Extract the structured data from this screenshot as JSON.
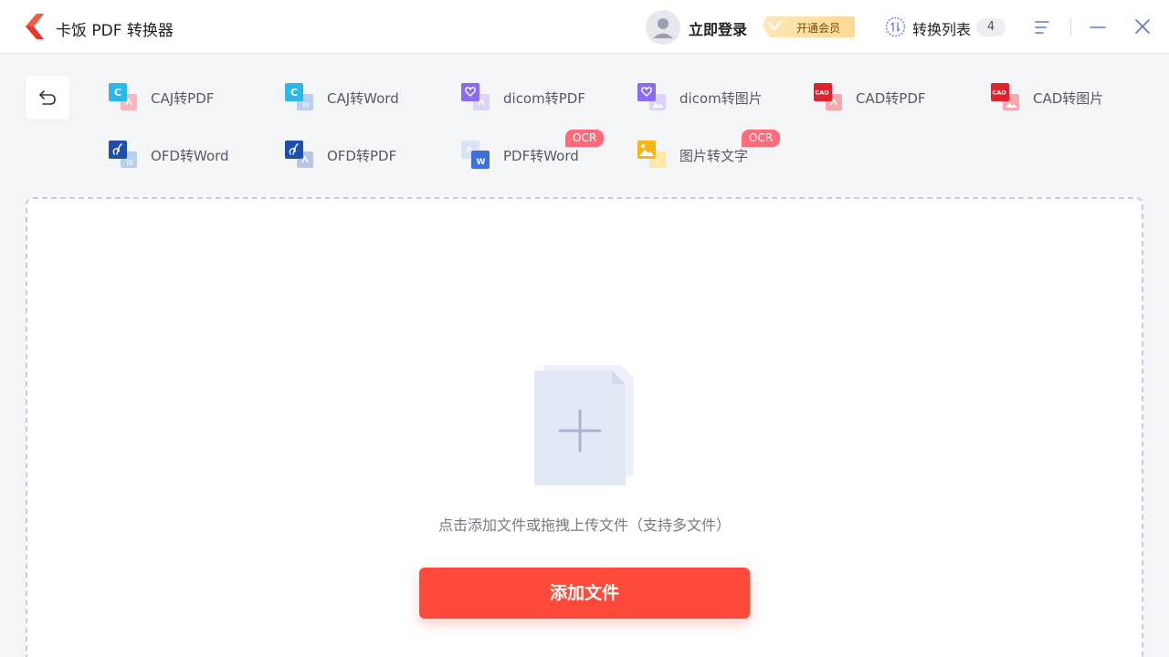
{
  "app": {
    "title": "卡饭 PDF 转换器"
  },
  "header": {
    "login_label": "立即登录",
    "vip_label": "开通会员",
    "convert_list_label": "转换列表",
    "convert_list_count": "4"
  },
  "tools": [
    {
      "label": "CAJ转PDF",
      "icon": "caj-to-pdf-icon"
    },
    {
      "label": "CAJ转Word",
      "icon": "caj-to-word-icon"
    },
    {
      "label": "dicom转PDF",
      "icon": "dicom-to-pdf-icon"
    },
    {
      "label": "dicom转图片",
      "icon": "dicom-to-image-icon"
    },
    {
      "label": "CAD转PDF",
      "icon": "cad-to-pdf-icon"
    },
    {
      "label": "CAD转图片",
      "icon": "cad-to-image-icon"
    },
    {
      "label": "OFD转Word",
      "icon": "ofd-to-word-icon"
    },
    {
      "label": "OFD转PDF",
      "icon": "ofd-to-pdf-icon"
    },
    {
      "label": "PDF转Word",
      "icon": "pdf-to-word-icon",
      "badge": "OCR"
    },
    {
      "label": "图片转文字",
      "icon": "image-to-text-icon",
      "badge": "OCR"
    }
  ],
  "dropzone": {
    "hint": "点击添加文件或拖拽上传文件（支持多文件）",
    "add_button_label": "添加文件"
  },
  "colors": {
    "accent": "#ff4a3a",
    "background": "#f4f5f7",
    "ocr_badge": "#ff6b7a",
    "dropzone_border": "#c6cbe8"
  }
}
